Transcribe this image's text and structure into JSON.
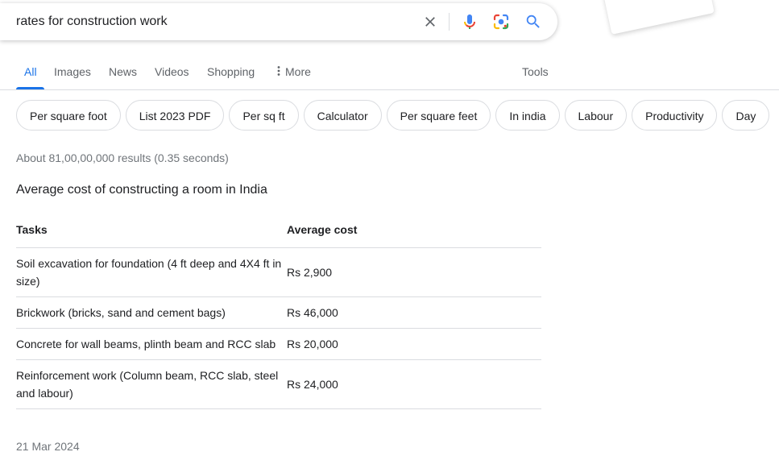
{
  "search": {
    "query": "rates for construction work"
  },
  "icons": {
    "clear": "close-icon",
    "voice": "microphone-icon",
    "lens": "camera-lens-icon",
    "search": "search-icon",
    "more": "vertical-dots-icon"
  },
  "tabs": [
    {
      "label": "All",
      "active": true
    },
    {
      "label": "Images"
    },
    {
      "label": "News"
    },
    {
      "label": "Videos"
    },
    {
      "label": "Shopping"
    },
    {
      "label": "More"
    }
  ],
  "tools_label": "Tools",
  "chips": [
    "Per square foot",
    "List 2023 PDF",
    "Per sq ft",
    "Calculator",
    "Per square feet",
    "In india",
    "Labour",
    "Productivity",
    "Day"
  ],
  "result_stats": "About 81,00,00,000 results (0.35 seconds)",
  "snippet": {
    "title": "Average cost of constructing a room in India",
    "headers": [
      "Tasks",
      "Average cost"
    ],
    "rows": [
      {
        "task": "Soil excavation for foundation (4 ft deep and 4X4 ft in size)",
        "cost": "Rs 2,900"
      },
      {
        "task": "Brickwork (bricks, sand and cement bags)",
        "cost": "Rs 46,000"
      },
      {
        "task": "Concrete for wall beams, plinth beam and RCC slab",
        "cost": "Rs 20,000"
      },
      {
        "task": "Reinforcement work (Column beam, RCC slab, steel and labour)",
        "cost": "Rs 24,000"
      }
    ],
    "date": "21 Mar 2024"
  },
  "colors": {
    "accent": "#1a73e8",
    "text": "#202124",
    "muted": "#70757a",
    "border": "#dadce0"
  }
}
